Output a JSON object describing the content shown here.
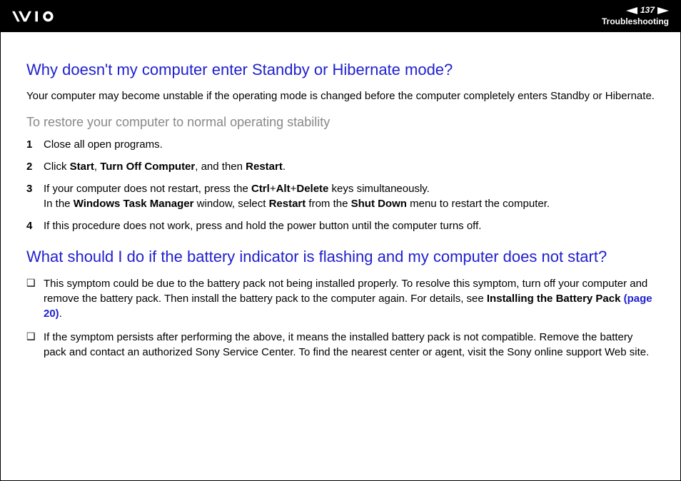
{
  "header": {
    "page_number": "137",
    "breadcrumb": "Troubleshooting"
  },
  "section1": {
    "heading": "Why doesn't my computer enter Standby or Hibernate mode?",
    "intro": "Your computer may become unstable if the operating mode is changed before the computer completely enters Standby or Hibernate.",
    "subhead": "To restore your computer to normal operating stability",
    "steps": [
      {
        "num": "1",
        "text": "Close all open programs."
      },
      {
        "num": "2",
        "prefix": "Click ",
        "b1": "Start",
        "sep1": ", ",
        "b2": "Turn Off Computer",
        "sep2": ", and then ",
        "b3": "Restart",
        "suffix": "."
      },
      {
        "num": "3",
        "line1_prefix": "If your computer does not restart, press the ",
        "ctrl": "Ctrl",
        "plus1": "+",
        "alt": "Alt",
        "plus2": "+",
        "del": "Delete",
        "line1_suffix": " keys simultaneously.",
        "line2_prefix": "In the ",
        "wtm": "Windows Task Manager",
        "line2_mid1": " window, select ",
        "restart": "Restart",
        "line2_mid2": " from the ",
        "shutdown": "Shut Down",
        "line2_suffix": " menu to restart the computer."
      },
      {
        "num": "4",
        "text": "If this procedure does not work, press and hold the power button until the computer turns off."
      }
    ]
  },
  "section2": {
    "heading": "What should I do if the battery indicator is flashing and my computer does not start?",
    "bullets": [
      {
        "prefix": "This symptom could be due to the battery pack not being installed properly. To resolve this symptom, turn off your computer and remove the battery pack. Then install the battery pack to the computer again. For details, see ",
        "bold": "Installing the Battery Pack ",
        "link": "(page 20)",
        "suffix": "."
      },
      {
        "text": "If the symptom persists after performing the above, it means the installed battery pack is not compatible. Remove the battery pack and contact an authorized Sony Service Center. To find the nearest center or agent, visit the Sony online support Web site."
      }
    ]
  }
}
